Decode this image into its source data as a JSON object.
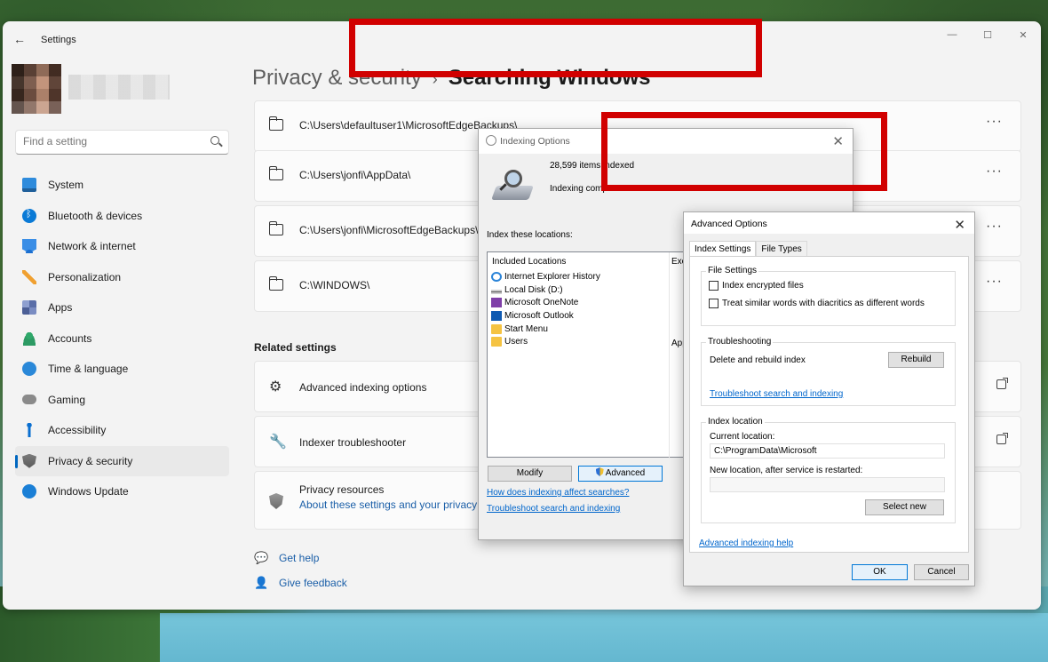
{
  "window": {
    "title": "Settings",
    "back_icon": "arrow-left-icon",
    "controls": [
      "minimize-icon",
      "maximize-icon",
      "close-icon"
    ]
  },
  "search": {
    "placeholder": "Find a setting",
    "icon": "search-icon"
  },
  "nav": {
    "items": [
      {
        "label": "System",
        "icon": "monitor-icon",
        "active": false
      },
      {
        "label": "Bluetooth & devices",
        "icon": "bluetooth-icon",
        "active": false
      },
      {
        "label": "Network & internet",
        "icon": "wifi-icon",
        "active": false
      },
      {
        "label": "Personalization",
        "icon": "brush-icon",
        "active": false
      },
      {
        "label": "Apps",
        "icon": "apps-icon",
        "active": false
      },
      {
        "label": "Accounts",
        "icon": "person-icon",
        "active": false
      },
      {
        "label": "Time & language",
        "icon": "globe-clock-icon",
        "active": false
      },
      {
        "label": "Gaming",
        "icon": "gamepad-icon",
        "active": false
      },
      {
        "label": "Accessibility",
        "icon": "accessibility-icon",
        "active": false
      },
      {
        "label": "Privacy & security",
        "icon": "shield-icon",
        "active": true
      },
      {
        "label": "Windows Update",
        "icon": "update-icon",
        "active": false
      }
    ]
  },
  "breadcrumb": {
    "parent": "Privacy & security",
    "separator": "›",
    "current": "Searching Windows"
  },
  "excluded_locations": [
    {
      "path": "C:\\Users\\defaultuser1\\MicrosoftEdgeBackups\\",
      "more": "···"
    },
    {
      "path": "C:\\Users\\jonfi\\AppData\\",
      "more": "···"
    },
    {
      "path": "C:\\Users\\jonfi\\MicrosoftEdgeBackups\\",
      "more": "···"
    },
    {
      "path": "C:\\WINDOWS\\",
      "more": "···"
    }
  ],
  "related": {
    "heading": "Related settings",
    "items": [
      {
        "label": "Advanced indexing options",
        "icon": "gear-icon"
      },
      {
        "label": "Indexer troubleshooter",
        "icon": "wrench-icon"
      }
    ],
    "privacy": {
      "title": "Privacy resources",
      "subtitle": "About these settings and your privacy",
      "icon": "shield-icon"
    }
  },
  "help": {
    "get_help": "Get help",
    "give_feedback": "Give feedback"
  },
  "indexing_dialog": {
    "title": "Indexing Options",
    "items_indexed": "28,599 items indexed",
    "status": "Indexing comp",
    "list_label": "Index these locations:",
    "column_included": "Included Locations",
    "column_exclude": "Exc",
    "locations": [
      {
        "name": "Internet Explorer History",
        "icon": "ie-icon"
      },
      {
        "name": "Local Disk (D:)",
        "icon": "drive-icon"
      },
      {
        "name": "Microsoft OneNote",
        "icon": "onenote-icon"
      },
      {
        "name": "Microsoft Outlook",
        "icon": "outlook-icon"
      },
      {
        "name": "Start Menu",
        "icon": "folder-icon"
      },
      {
        "name": "Users",
        "icon": "folder-icon",
        "exclude": "App"
      }
    ],
    "modify_label": "Modify",
    "advanced_label": "Advanced",
    "link_affect": "How does indexing affect searches?",
    "link_troubleshoot": "Troubleshoot search and indexing"
  },
  "advanced_dialog": {
    "title": "Advanced Options",
    "tabs": [
      "Index Settings",
      "File Types"
    ],
    "file_settings": {
      "title": "File Settings",
      "encrypt": "Index encrypted files",
      "diacritics": "Treat similar words with diacritics as different words"
    },
    "troubleshooting": {
      "title": "Troubleshooting",
      "rebuild_text": "Delete and rebuild index",
      "rebuild_button": "Rebuild",
      "link": "Troubleshoot search and indexing"
    },
    "index_location": {
      "title": "Index location",
      "current_label": "Current location:",
      "current_value": "C:\\ProgramData\\Microsoft",
      "new_label": "New location, after service is restarted:",
      "new_value": "",
      "select_button": "Select new"
    },
    "help_link": "Advanced indexing help",
    "ok": "OK",
    "cancel": "Cancel"
  }
}
